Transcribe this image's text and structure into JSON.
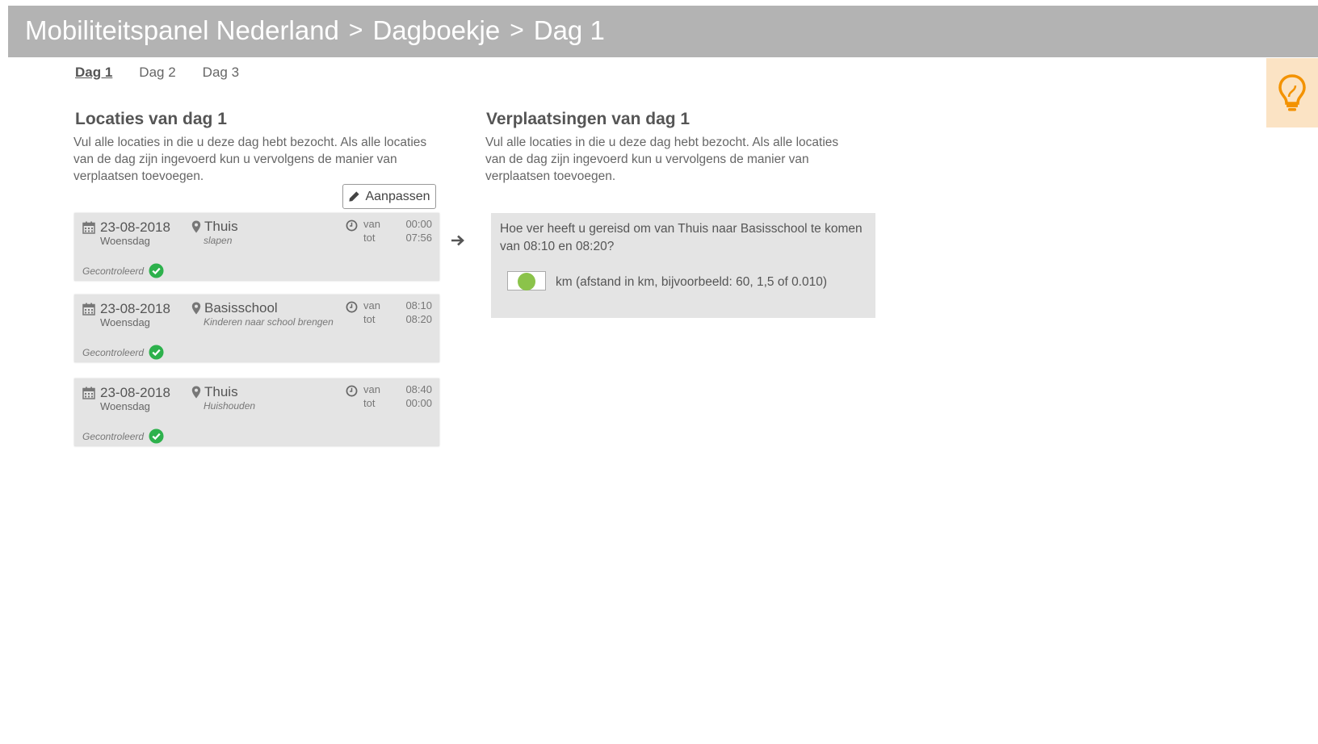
{
  "header": {
    "crumbs": [
      "Mobiliteitspanel Nederland",
      "Dagboekje",
      "Dag 1"
    ],
    "separator": ">"
  },
  "tabs": [
    "Dag 1",
    "Dag 2",
    "Dag 3"
  ],
  "active_tab": "Dag 1",
  "locations": {
    "title": "Locaties van dag 1",
    "description": "Vul alle locaties in die u deze dag hebt bezocht. Als alle locaties van de dag zijn ingevoerd kun u vervolgens de manier van verplaatsen toevoegen.",
    "edit_label": "Aanpassen",
    "van_label": "van",
    "tot_label": "tot",
    "items": [
      {
        "date": "23-08-2018",
        "weekday": "Woensdag",
        "place": "Thuis",
        "activity": "slapen",
        "from": "00:00",
        "to": "07:56",
        "status": "Gecontroleerd"
      },
      {
        "date": "23-08-2018",
        "weekday": "Woensdag",
        "place": "Basisschool",
        "activity": "Kinderen naar school brengen",
        "from": "08:10",
        "to": "08:20",
        "status": "Gecontroleerd"
      },
      {
        "date": "23-08-2018",
        "weekday": "Woensdag",
        "place": "Thuis",
        "activity": "Huishouden",
        "from": "08:40",
        "to": "00:00",
        "status": "Gecontroleerd"
      }
    ]
  },
  "trips": {
    "title": "Verplaatsingen van dag 1",
    "description": "Vul alle locaties in die u deze dag hebt bezocht. Als alle locaties van de dag zijn ingevoerd kun u vervolgens de manier van verplaatsen toevoegen.",
    "question": "Hoe ver heeft u gereisd om van Thuis naar Basisschool te komen van 08:10 en 08:20?",
    "km_label": "km  (afstand in km, bijvoorbeeld: 60, 1,5 of 0.010)"
  },
  "colors": {
    "header_bg": "#b3b3b3",
    "card_bg": "#e4e4e4",
    "check_green": "#2db14c",
    "input_dot": "#8bc34a",
    "bulb": "#f39200",
    "bulb_bg": "#fbe3c4"
  },
  "icons": [
    "calendar-icon",
    "map-marker-icon",
    "clock-icon",
    "check-circle-icon",
    "pencil-icon",
    "arrow-right-icon",
    "lightbulb-icon"
  ]
}
